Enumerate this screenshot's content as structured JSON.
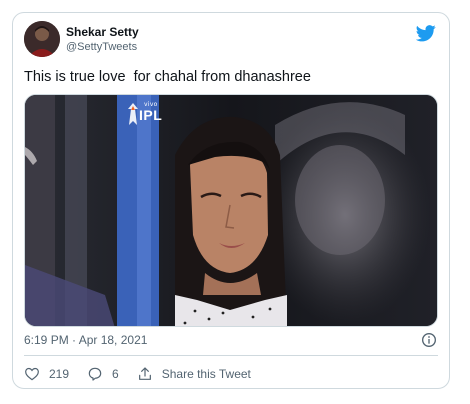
{
  "author": {
    "display_name": "Shekar Setty",
    "handle": "@SettyTweets"
  },
  "tweet": {
    "text": "This is true love  for chahal from dhanashree",
    "timestamp": "6:19 PM · Apr 18, 2021"
  },
  "media": {
    "logo_brand": "vivo",
    "logo_text": "IPL"
  },
  "actions": {
    "like_count": "219",
    "reply_count": "6",
    "share_label": "Share this Tweet"
  },
  "icons": {
    "brand": "twitter-bird-icon",
    "info": "info-icon",
    "like": "heart-icon",
    "reply": "reply-bubble-icon",
    "share": "share-icon"
  },
  "colors": {
    "twitter_blue": "#1d9bf0",
    "secondary_text": "#536471",
    "border": "#cfd9de"
  }
}
